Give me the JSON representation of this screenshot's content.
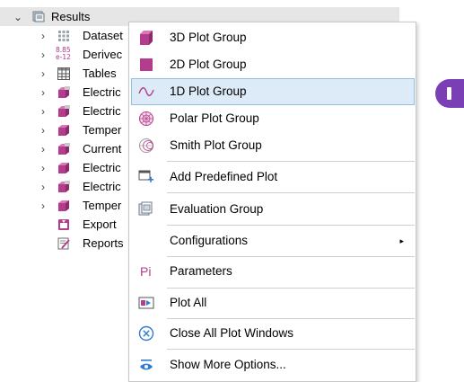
{
  "tree": {
    "root": {
      "label": "Results",
      "icon": "results-icon"
    },
    "items": [
      {
        "label": "Dataset",
        "icon": "dataset-icon",
        "expander": "›"
      },
      {
        "label": "Derivec",
        "icon": "derived-values-icon",
        "icon_text": "8.85\ne-12",
        "expander": "›"
      },
      {
        "label": "Tables",
        "icon": "table-icon",
        "expander": "›"
      },
      {
        "label": "Electric",
        "icon": "3d-plot-group-icon",
        "expander": "›"
      },
      {
        "label": "Electric",
        "icon": "3d-plot-group-icon",
        "expander": "›"
      },
      {
        "label": "Temper",
        "icon": "3d-plot-group-icon",
        "expander": "›"
      },
      {
        "label": "Current",
        "icon": "3d-plot-group-icon",
        "expander": "›"
      },
      {
        "label": "Electric",
        "icon": "3d-plot-group-icon",
        "expander": "›"
      },
      {
        "label": "Electric",
        "icon": "3d-plot-group-icon",
        "expander": "›"
      },
      {
        "label": "Temper",
        "icon": "3d-plot-group-icon",
        "expander": "›"
      },
      {
        "label": "Export",
        "icon": "export-icon",
        "expander": ""
      },
      {
        "label": "Reports",
        "icon": "reports-icon",
        "expander": ""
      }
    ]
  },
  "menu": {
    "items": [
      {
        "label": "3D Plot Group",
        "icon": "3d-plot-group-icon"
      },
      {
        "label": "2D Plot Group",
        "icon": "2d-plot-group-icon"
      },
      {
        "label": "1D Plot Group",
        "icon": "1d-plot-group-icon",
        "highlighted": true
      },
      {
        "label": "Polar Plot Group",
        "icon": "polar-plot-group-icon"
      },
      {
        "label": "Smith Plot Group",
        "icon": "smith-plot-group-icon"
      },
      {
        "label": "Add Predefined Plot",
        "icon": "add-predefined-plot-icon"
      },
      {
        "label": "Evaluation Group",
        "icon": "evaluation-group-icon"
      },
      {
        "label": "Configurations",
        "icon": "",
        "submenu_arrow": "▸"
      },
      {
        "label": "Parameters",
        "icon": "parameters-icon",
        "icon_text": "Pi"
      },
      {
        "label": "Plot All",
        "icon": "plot-all-icon"
      },
      {
        "label": "Close All Plot Windows",
        "icon": "close-circle-icon"
      },
      {
        "label": "Show More Options...",
        "icon": "show-more-options-icon"
      }
    ]
  },
  "colors": {
    "magenta": "#b43c8c",
    "highlight_bg": "#ddeaf7",
    "highlight_border": "#90bfe6",
    "accent_purple": "#7b3fb5"
  }
}
